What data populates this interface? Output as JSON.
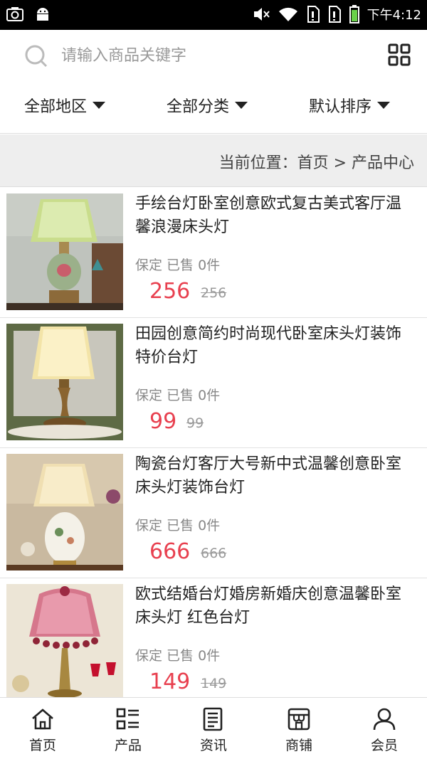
{
  "status_bar": {
    "time": "下午4:12",
    "icons": [
      "screenshot-icon",
      "android-icon",
      "mute-icon",
      "wifi-icon",
      "sim1-icon",
      "sim2-icon",
      "battery-icon"
    ]
  },
  "search": {
    "placeholder": "请输入商品关键字"
  },
  "filters": [
    {
      "label": "全部地区"
    },
    {
      "label": "全部分类"
    },
    {
      "label": "默认排序"
    }
  ],
  "breadcrumb": {
    "text": "当前位置：首页 > 产品中心"
  },
  "products": [
    {
      "title": "手绘台灯卧室创意欧式复古美式客厅温馨浪漫床头灯",
      "meta": "保定 已售 0件",
      "price": "256",
      "old_price": "256"
    },
    {
      "title": "田园创意简约时尚现代卧室床头灯装饰特价台灯",
      "meta": "保定 已售 0件",
      "price": "99",
      "old_price": "99"
    },
    {
      "title": "陶瓷台灯客厅大号新中式温馨创意卧室床头灯装饰台灯",
      "meta": "保定 已售 0件",
      "price": "666",
      "old_price": "666"
    },
    {
      "title": "欧式结婚台灯婚房新婚庆创意温馨卧室床头灯 红色台灯",
      "meta": "保定 已售 0件",
      "price": "149",
      "old_price": "149"
    }
  ],
  "bottom_nav": [
    {
      "label": "首页",
      "icon": "home-icon"
    },
    {
      "label": "产品",
      "icon": "product-list-icon"
    },
    {
      "label": "资讯",
      "icon": "news-icon"
    },
    {
      "label": "商铺",
      "icon": "shop-icon"
    },
    {
      "label": "会员",
      "icon": "member-icon"
    }
  ],
  "colors": {
    "price": "#e8404f",
    "status_bar": "#000000",
    "breadcrumb_bg": "#eeeeee"
  }
}
